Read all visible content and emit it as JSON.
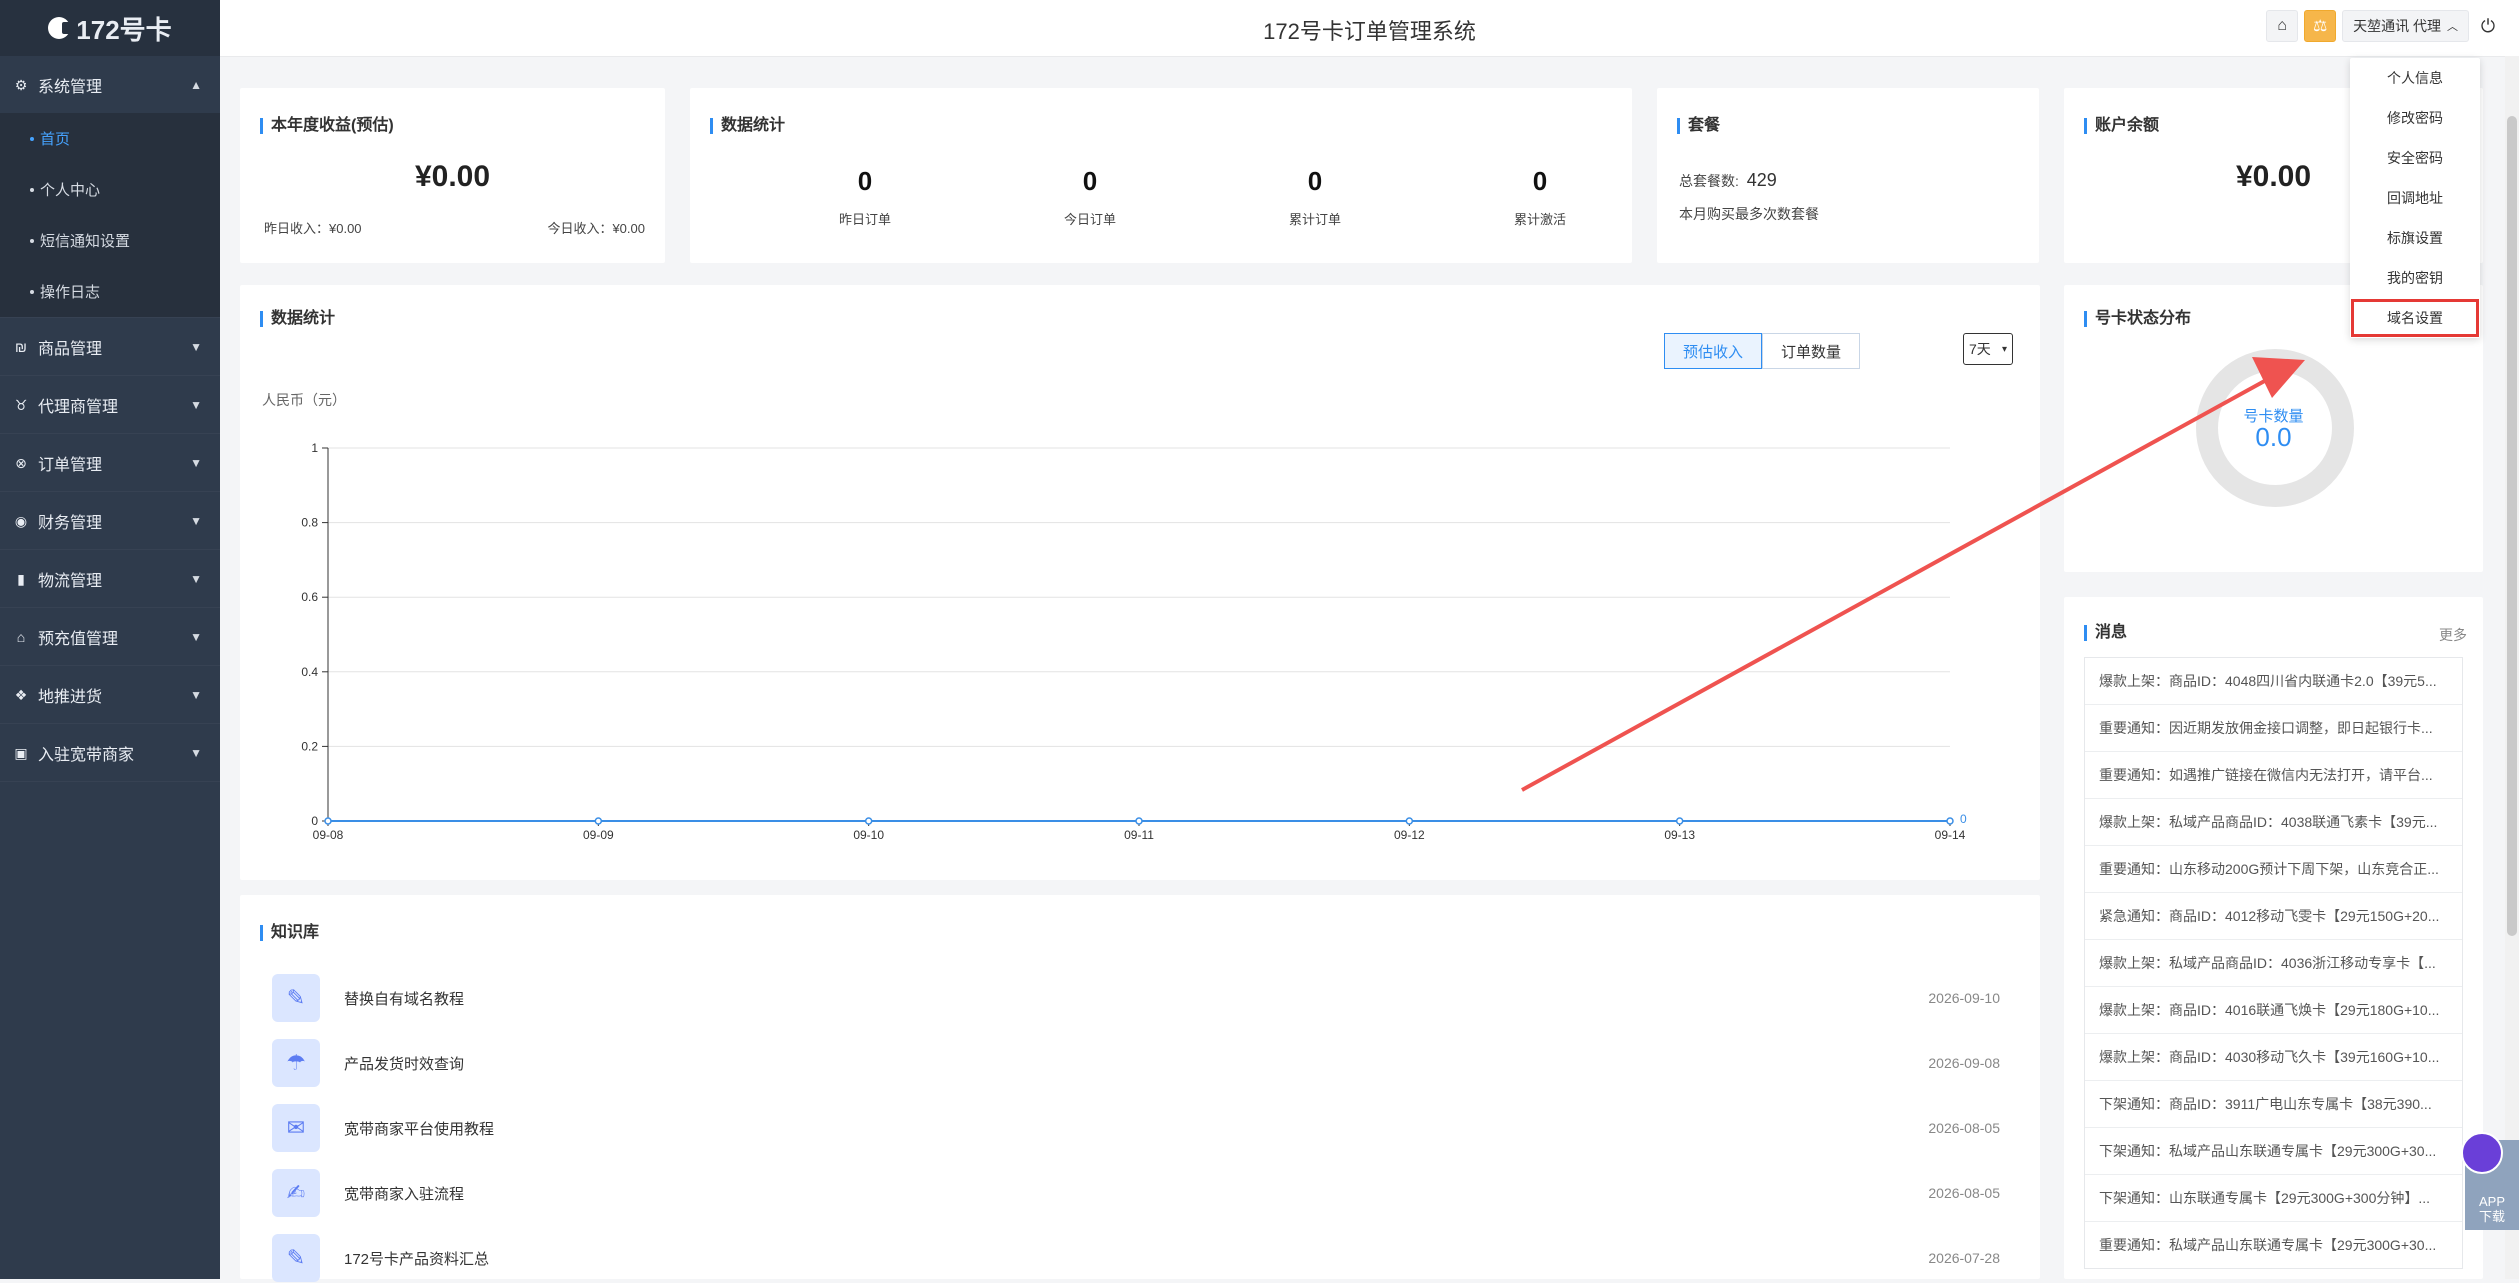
{
  "brand": {
    "name": "172号卡"
  },
  "header": {
    "title": "172号卡订单管理系统",
    "user_label": "天堃通讯 代理"
  },
  "sidebar": {
    "groups": [
      {
        "label": "系统管理",
        "icon": "gear-icon",
        "open": true,
        "items": [
          {
            "label": "首页",
            "active": true
          },
          {
            "label": "个人中心"
          },
          {
            "label": "短信通知设置"
          },
          {
            "label": "操作日志"
          }
        ]
      },
      {
        "label": "商品管理",
        "icon": "product-icon"
      },
      {
        "label": "代理商管理",
        "icon": "agent-icon"
      },
      {
        "label": "订单管理",
        "icon": "order-icon"
      },
      {
        "label": "财务管理",
        "icon": "finance-icon"
      },
      {
        "label": "物流管理",
        "icon": "bookmark-icon"
      },
      {
        "label": "预充值管理",
        "icon": "tag-icon"
      },
      {
        "label": "地推进货",
        "icon": "cubes-icon"
      },
      {
        "label": "入驻宽带商家",
        "icon": "money-icon"
      }
    ]
  },
  "cards": {
    "income": {
      "title": "本年度收益(预估)",
      "amount": "¥0.00",
      "yesterday": "昨日收入：¥0.00",
      "today": "今日收入：¥0.00"
    },
    "stats": {
      "title": "数据统计",
      "items": [
        {
          "value": "0",
          "label": "昨日订单"
        },
        {
          "value": "0",
          "label": "今日订单"
        },
        {
          "value": "0",
          "label": "累计订单"
        },
        {
          "value": "0",
          "label": "累计激活"
        }
      ]
    },
    "package": {
      "title": "套餐",
      "total_label": "总套餐数:",
      "total_value": "429",
      "note": "本月购买最多次数套餐"
    },
    "balance": {
      "title": "账户余额",
      "amount": "¥0.00"
    }
  },
  "chart_panel": {
    "title": "数据统计",
    "tabs": [
      "预估收入",
      "订单数量"
    ],
    "active_tab": 0,
    "range": "7天",
    "unit": "人民币（元）"
  },
  "chart_data": {
    "type": "line",
    "x": [
      "09-08",
      "09-09",
      "09-10",
      "09-11",
      "09-12",
      "09-13",
      "09-14"
    ],
    "series": [
      {
        "values": [
          0,
          0,
          0,
          0,
          0,
          0,
          0
        ]
      }
    ],
    "ylim": [
      0,
      1
    ],
    "yticks": [
      "0",
      "0.2",
      "0.4",
      "0.6",
      "0.8",
      "1"
    ],
    "end_label": "0",
    "grid": true,
    "color": "#3a8ee6"
  },
  "card_status": {
    "title": "号卡状态分布",
    "label": "号卡数量",
    "value": "0.0"
  },
  "knowledge": {
    "title": "知识库",
    "items": [
      {
        "title": "替换自有域名教程",
        "date": "2026-09-10"
      },
      {
        "title": "产品发货时效查询",
        "date": "2026-09-08"
      },
      {
        "title": "宽带商家平台使用教程",
        "date": "2026-08-05"
      },
      {
        "title": "宽带商家入驻流程",
        "date": "2026-08-05"
      },
      {
        "title": "172号卡产品资料汇总",
        "date": "2026-07-28"
      }
    ]
  },
  "messages": {
    "title": "消息",
    "more": "更多",
    "items": [
      "爆款上架：商品ID：4048四川省内联通卡2.0【39元5...",
      "重要通知：因近期发放佣金接口调整，即日起银行卡...",
      "重要通知：如遇推广链接在微信内无法打开，请平台...",
      "爆款上架：私域产品商品ID：4038联通飞素卡【39元...",
      "重要通知：山东移动200G预计下周下架，山东竞合正...",
      "紧急通知：商品ID：4012移动飞雯卡【29元150G+20...",
      "爆款上架：私域产品商品ID：4036浙江移动专享卡【...",
      "爆款上架：商品ID：4016联通飞焕卡【29元180G+10...",
      "爆款上架：商品ID：4030移动飞久卡【39元160G+10...",
      "下架通知：商品ID：3911广电山东专属卡【38元390...",
      "下架通知：私域产品山东联通专属卡【29元300G+30...",
      "下架通知：山东联通专属卡【29元300G+300分钟】...",
      "重要通知：私域产品山东联通专属卡【29元300G+30..."
    ]
  },
  "dropdown": {
    "items": [
      "个人信息",
      "修改密码",
      "安全密码",
      "回调地址",
      "标旗设置",
      "我的密钥",
      "域名设置"
    ],
    "highlight_index": 6
  },
  "app_download": {
    "label": "APP\n下载"
  },
  "colors": {
    "accent": "#2e8df2",
    "sidebar": "#2f3b4c",
    "highlight": "#e53935"
  }
}
